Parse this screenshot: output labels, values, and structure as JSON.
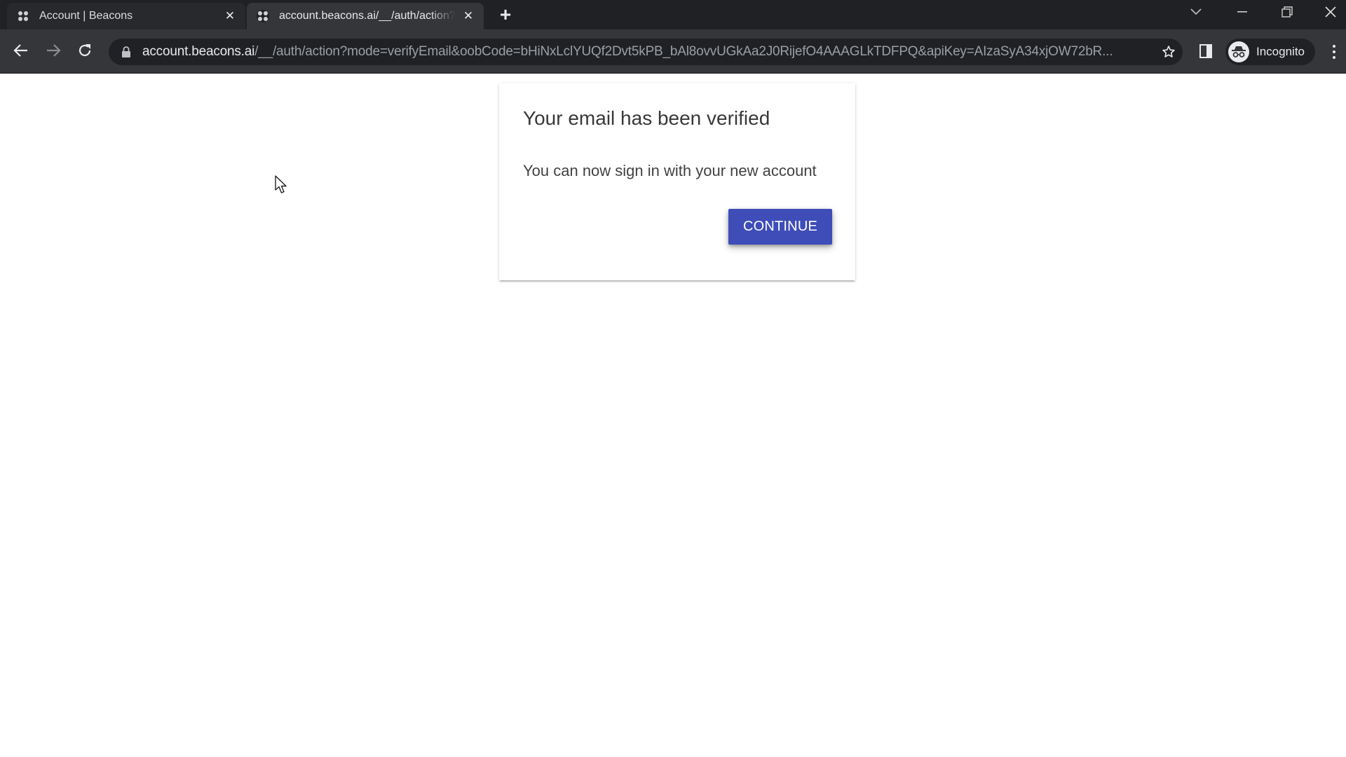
{
  "browser": {
    "tabs": [
      {
        "title": "Account | Beacons",
        "active": false,
        "favicon": "beacons-favicon"
      },
      {
        "title": "account.beacons.ai/__/auth/action?mode=verifyEmail",
        "active": true,
        "favicon": "beacons-favicon"
      }
    ],
    "new_tab_icon": "plus-icon",
    "window_controls": [
      "tab-search",
      "minimize",
      "restore",
      "close"
    ],
    "address_bar": {
      "host": "account.beacons.ai",
      "path": "/__/auth/action?mode=verifyEmail&oobCode=bHiNxLclYUQf2Dvt5kPB_bAl8ovvUGkAa2J0RijefO4AAAGLkTDFPQ&apiKey=AIzaSyA34xjOW72bR...",
      "security_icon": "lock-icon"
    },
    "profile_label": "Incognito"
  },
  "card": {
    "title": "Your email has been verified",
    "message": "You can now sign in with your new account",
    "button_label": "CONTINUE"
  },
  "colors": {
    "button": "#3f4db8",
    "tabbar": "#202124",
    "toolbar": "#35363a"
  }
}
